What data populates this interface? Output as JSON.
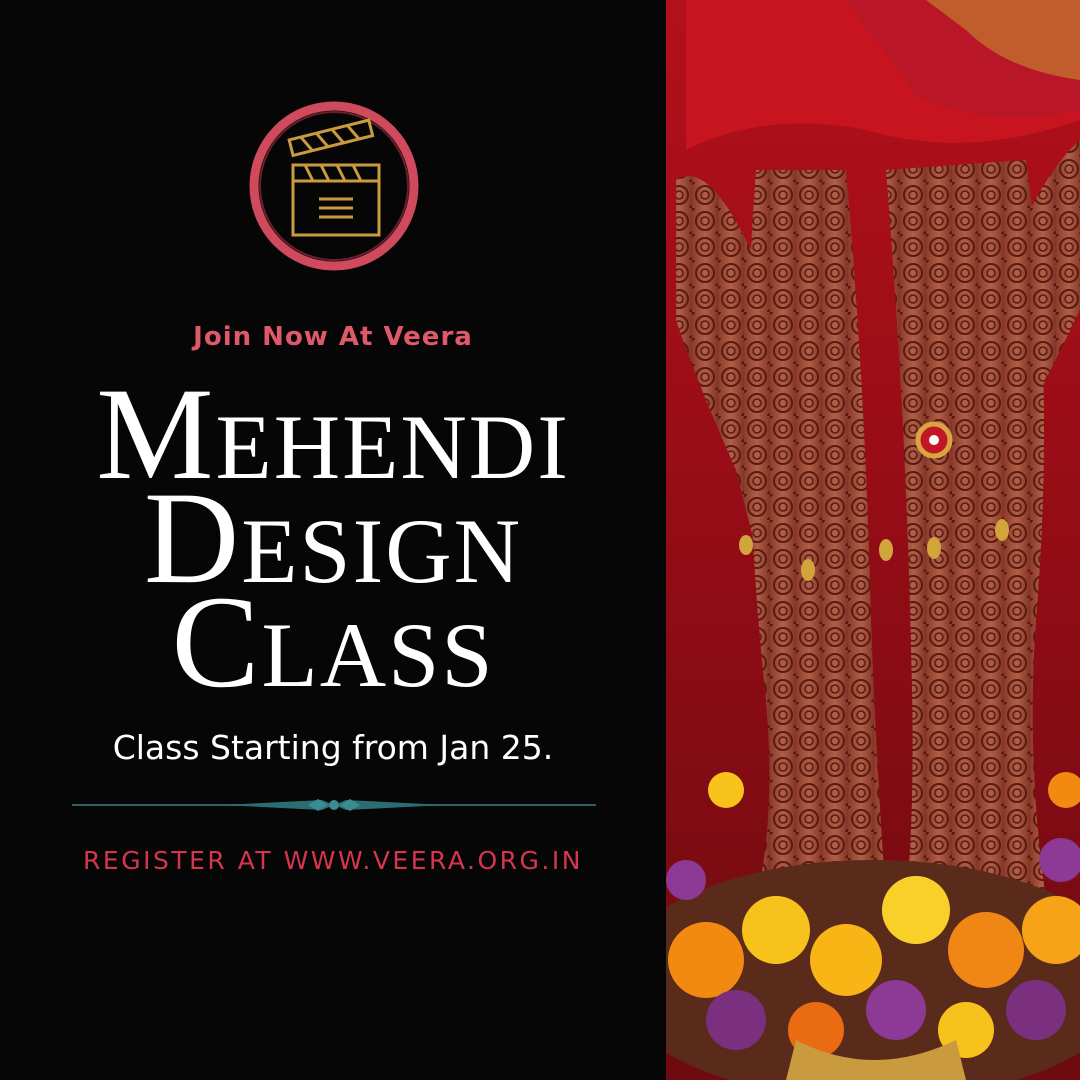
{
  "poster": {
    "eyebrow": "Join Now At Veera",
    "title_lines": [
      "Mehendi",
      "Design",
      "Class"
    ],
    "subtitle": "Class Starting from Jan 25.",
    "register": "REGISTER AT WWW.VEERA.ORG.IN"
  },
  "colors": {
    "background": "#060606",
    "accent_pink": "#e0596b",
    "accent_red": "#d6364d",
    "logo_ring": "#cf4a5c",
    "logo_gold": "#c99a3e",
    "divider": "#2f5f66"
  },
  "icons": {
    "logo": "clapperboard-icon"
  }
}
